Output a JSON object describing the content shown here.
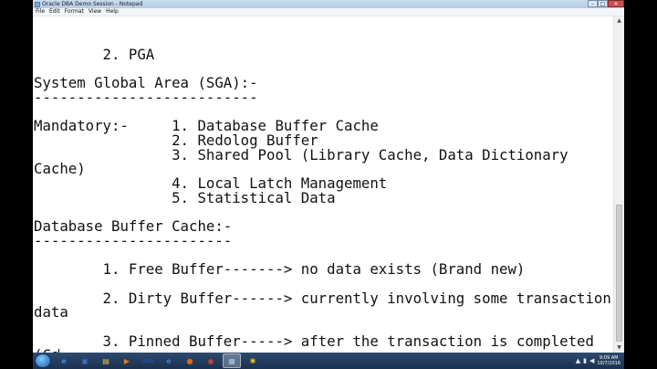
{
  "window": {
    "title": "Oracle DBA Demo Session - Notepad"
  },
  "menu": [
    "File",
    "Edit",
    "Format",
    "View",
    "Help"
  ],
  "lines": [
    "",
    "        2. PGA",
    "",
    "System Global Area (SGA):-",
    "--------------------------",
    "",
    "Mandatory:-     1. Database Buffer Cache",
    "                2. Redolog Buffer",
    "                3. Shared Pool (Library Cache, Data Dictionary",
    "Cache)",
    "                4. Local Latch Management",
    "                5. Statistical Data",
    "",
    "Database Buffer Cache:-",
    "-----------------------",
    "",
    "        1. Free Buffer-------> no data exists (Brand new)",
    "",
    "        2. Dirty Buffer------> currently involving some transaction",
    "data",
    "",
    "        3. Pinned Buffer-----> after the transaction is completed",
    "(Co"
  ],
  "taskbar": {
    "apps": [
      {
        "name": "ie-icon",
        "glyph": "e",
        "color": "#3a8ee6"
      },
      {
        "name": "virtualbox-icon",
        "glyph": "▣",
        "color": "#3b6fb6"
      },
      {
        "name": "explorer-icon",
        "glyph": "▤",
        "color": "#f0c040"
      },
      {
        "name": "media-player-icon",
        "glyph": "▶",
        "color": "#e07b20"
      },
      {
        "name": "sas-icon",
        "glyph": "SAS",
        "color": "#1f4e9c"
      },
      {
        "name": "ie-icon-2",
        "glyph": "e",
        "color": "#2f7fd6"
      },
      {
        "name": "firefox-icon",
        "glyph": "●",
        "color": "#e8651e"
      },
      {
        "name": "chrome-icon",
        "glyph": "◉",
        "color": "#d64a3a"
      },
      {
        "name": "notepad-icon",
        "glyph": "▦",
        "color": "#a8c8ea"
      },
      {
        "name": "app-icon-yellow",
        "glyph": "✱",
        "color": "#f0c020"
      }
    ],
    "clock": {
      "time": "9:09 AM",
      "date": "10/7/2016"
    }
  }
}
